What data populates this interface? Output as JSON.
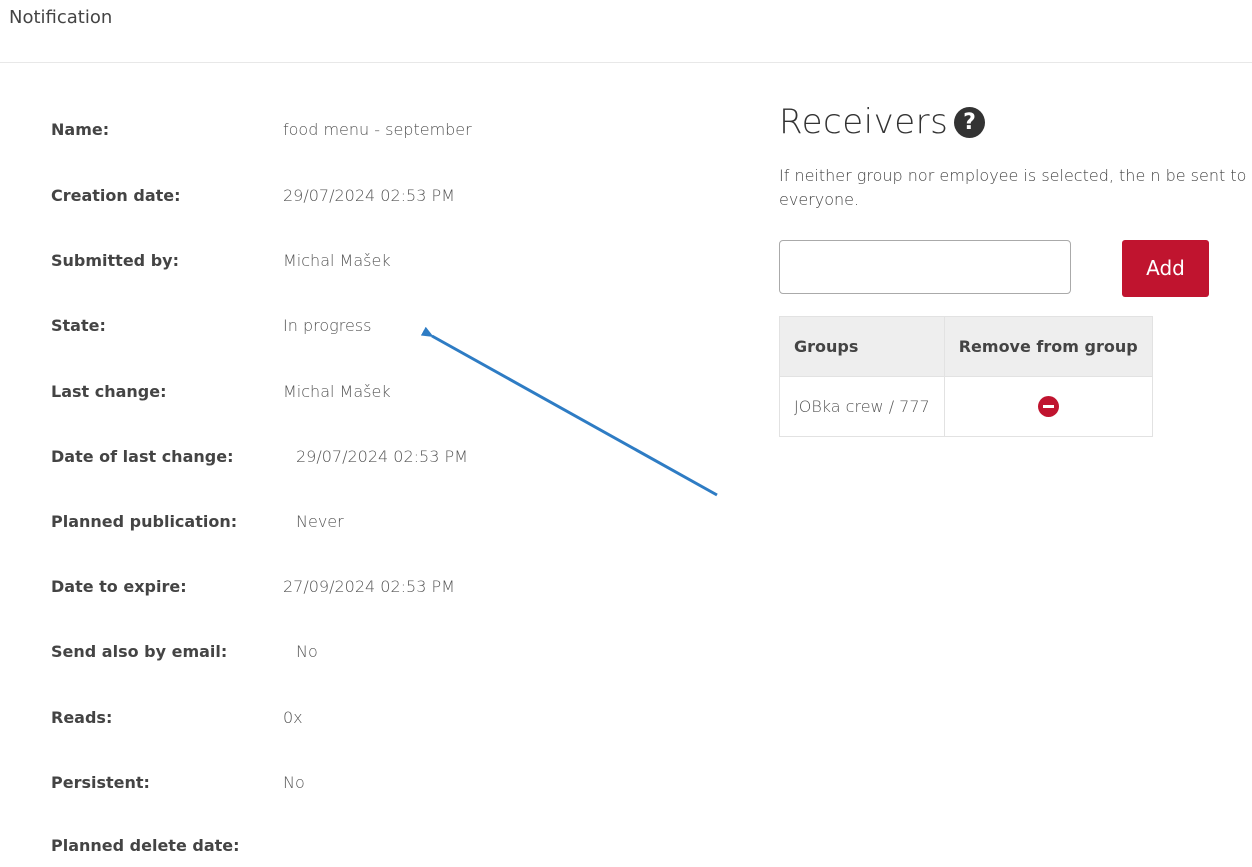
{
  "header": {
    "title": "Notification"
  },
  "details": [
    {
      "label": "Name:",
      "value": "food menu - september"
    },
    {
      "label": "Creation date:",
      "value": "29/07/2024 02:53 PM"
    },
    {
      "label": "Submitted by:",
      "value": "Michal Mašek"
    },
    {
      "label": "State:",
      "value": "In progress"
    },
    {
      "label": "Last change:",
      "value": "Michal Mašek"
    },
    {
      "label": "Date of last change:",
      "value": "29/07/2024 02:53 PM"
    },
    {
      "label": "Planned publication:",
      "value": "Never"
    },
    {
      "label": "Date to expire:",
      "value": "27/09/2024 02:53 PM"
    },
    {
      "label": "Send also by email:",
      "value": "No"
    },
    {
      "label": "Reads:",
      "value": "0x"
    },
    {
      "label": "Persistent:",
      "value": "No"
    },
    {
      "label": "Planned delete date:",
      "value": ""
    }
  ],
  "receivers": {
    "title": "Receivers",
    "help_icon": "question-circle-icon",
    "note": "If neither group nor employee is selected, the n be sent to everyone.",
    "input": {
      "value": "",
      "placeholder": ""
    },
    "add_label": "Add",
    "table": {
      "headers": [
        "Groups",
        "Remove from group"
      ],
      "rows": [
        {
          "group": "JOBka crew / 777",
          "remove_icon": "minus-circle-icon"
        }
      ]
    }
  },
  "colors": {
    "accent": "#c0142f",
    "arrow": "#2e7cc4"
  }
}
